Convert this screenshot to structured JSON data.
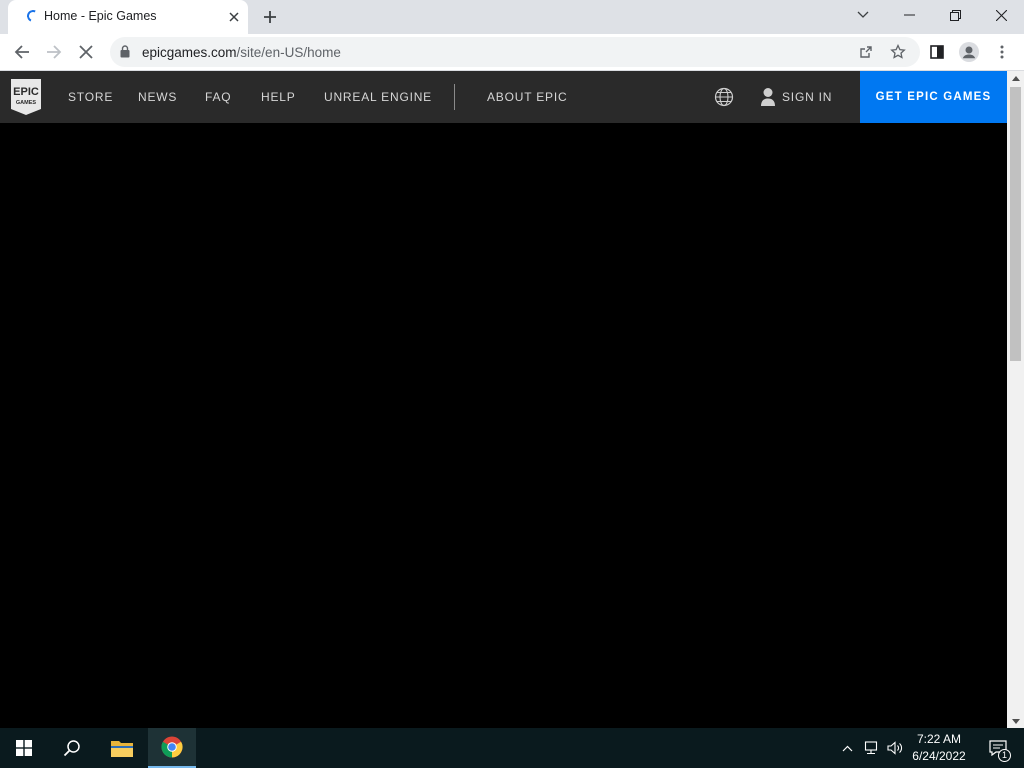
{
  "browser": {
    "tab": {
      "title": "Home - Epic Games"
    },
    "address": {
      "host": "epicgames.com",
      "path": "/site/en-US/home"
    }
  },
  "site": {
    "logo": {
      "line1": "EPIC",
      "line2": "GAMES"
    },
    "nav": [
      {
        "label": "STORE"
      },
      {
        "label": "NEWS"
      },
      {
        "label": "FAQ"
      },
      {
        "label": "HELP"
      },
      {
        "label": "UNREAL ENGINE"
      },
      {
        "label": "ABOUT EPIC"
      }
    ],
    "sign_in_label": "SIGN IN",
    "cta_label": "GET EPIC GAMES",
    "colors": {
      "nav_bg": "#2a2a2a",
      "cta": "#0078f2"
    }
  },
  "taskbar": {
    "time": "7:22 AM",
    "date": "6/24/2022",
    "notification_count": "1"
  },
  "icons": [
    "spinner-icon",
    "close-icon",
    "plus-icon",
    "chevron-down-icon",
    "minimize-icon",
    "restore-icon",
    "back-icon",
    "forward-icon",
    "stop-icon",
    "lock-icon",
    "share-icon",
    "star-icon",
    "sidepanel-icon",
    "profile-icon",
    "kebab-icon",
    "globe-icon",
    "user-icon",
    "windows-start-icon",
    "search-icon",
    "file-explorer-icon",
    "chrome-icon",
    "caret-up-icon",
    "network-icon",
    "volume-icon",
    "notification-icon"
  ]
}
